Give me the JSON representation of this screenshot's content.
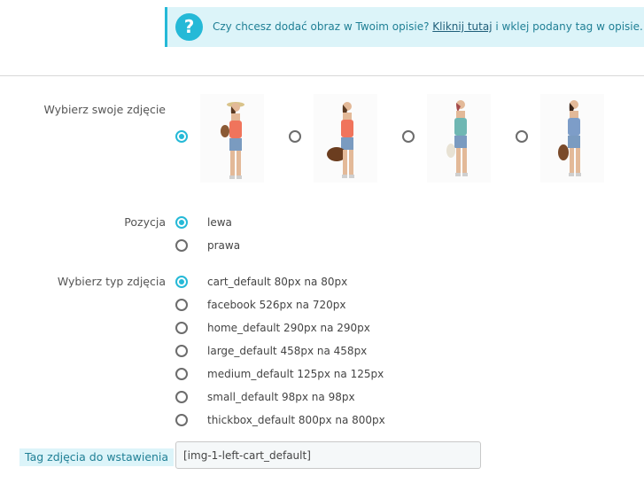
{
  "alert": {
    "text_before": "Czy chcesz dodać obraz w Twoim opisie?",
    "link": "Kliknij tutaj",
    "text_after": "i wklej podany tag w opisie."
  },
  "image_choice": {
    "label": "Wybierz swoje zdjęcie",
    "selected_index": 0,
    "photos": [
      "photo-1",
      "photo-2",
      "photo-3",
      "photo-4"
    ]
  },
  "position": {
    "label": "Pozycja",
    "options": [
      "lewa",
      "prawa"
    ],
    "selected_index": 0
  },
  "image_type": {
    "label": "Wybierz typ zdjęcia",
    "options": [
      "cart_default 80px na 80px",
      "facebook 526px na 720px",
      "home_default 290px na 290px",
      "large_default 458px na 458px",
      "medium_default 125px na 125px",
      "small_default 98px na 98px",
      "thickbox_default 800px na 800px"
    ],
    "selected_index": 0
  },
  "tag": {
    "label": "Tag zdjęcia do wstawienia",
    "value": "[img-1-left-cart_default]"
  },
  "colors": {
    "accent": "#25b9d7",
    "alert_bg": "#dcf4f9"
  }
}
